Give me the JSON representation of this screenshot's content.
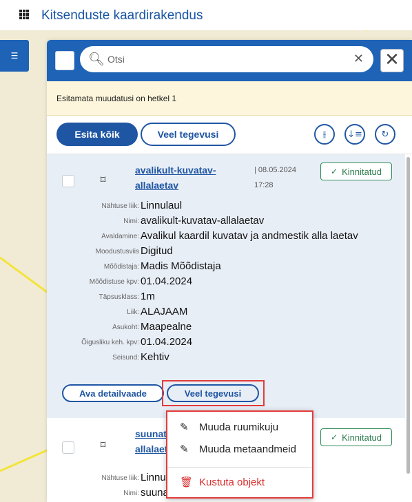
{
  "app": {
    "title": "Kitsenduste kaardirakendus"
  },
  "search": {
    "placeholder": "Otsi"
  },
  "notice": {
    "text": "Esitamata muudatusi on hetkel 1"
  },
  "toolbar": {
    "submit_all_label": "Esita kõik",
    "more_actions_label": "Veel tegevusi"
  },
  "cards": [
    {
      "title_line1": "avalikult-kuvatav-",
      "title_line2": "allalaetav",
      "date_line1": "| 08.05.2024",
      "date_line2": "17:28",
      "status": "Kinnitatud",
      "fields": [
        {
          "label": "Nähtuse liik:",
          "value": "Linnulaul"
        },
        {
          "label": "Nimi:",
          "value": "avalikult-kuvatav-allalaetav"
        },
        {
          "label": "Avaldamine:",
          "value": "Avalikul kaardil kuvatav ja andmestik alla laetav"
        },
        {
          "label": "Moodustusviis",
          "value": "Digitud"
        },
        {
          "label": "Mõõdistaja:",
          "value": "Madis Mõõdistaja"
        },
        {
          "label": "Mõõdistuse kpv:",
          "value": "01.04.2024"
        },
        {
          "label": "Täpsusklass:",
          "value": "1m"
        },
        {
          "label": "Liik:",
          "value": "ALAJAAM"
        },
        {
          "label": "Asukoht:",
          "value": "Maapealne"
        },
        {
          "label": "Õigusliku keh. kpv:",
          "value": "01.04.2024"
        },
        {
          "label": "Seisund:",
          "value": "Kehtiv"
        }
      ],
      "open_detail_label": "Ava detailvaade",
      "more_actions_label": "Veel tegevusi"
    },
    {
      "title_line1": "suunat",
      "title_line2": "allalaet",
      "status": "Kinnitatud",
      "fields": [
        {
          "label": "Nähtuse liik:",
          "value": "Linnul"
        },
        {
          "label": "Nimi:",
          "value": "suuna"
        }
      ]
    }
  ],
  "menu": {
    "items": [
      {
        "label": "Muuda ruumikuju",
        "icon": "edit-icon"
      },
      {
        "label": "Muuda metaandmeid",
        "icon": "edit-icon"
      },
      {
        "label": "Kustuta objekt",
        "icon": "trash-icon",
        "color": "#d9302e"
      }
    ]
  },
  "colors": {
    "primary": "#1f56a3",
    "header": "#1f63b6",
    "success": "#2e7d4f",
    "danger": "#d9302e",
    "highlight": "#e23b3b"
  }
}
